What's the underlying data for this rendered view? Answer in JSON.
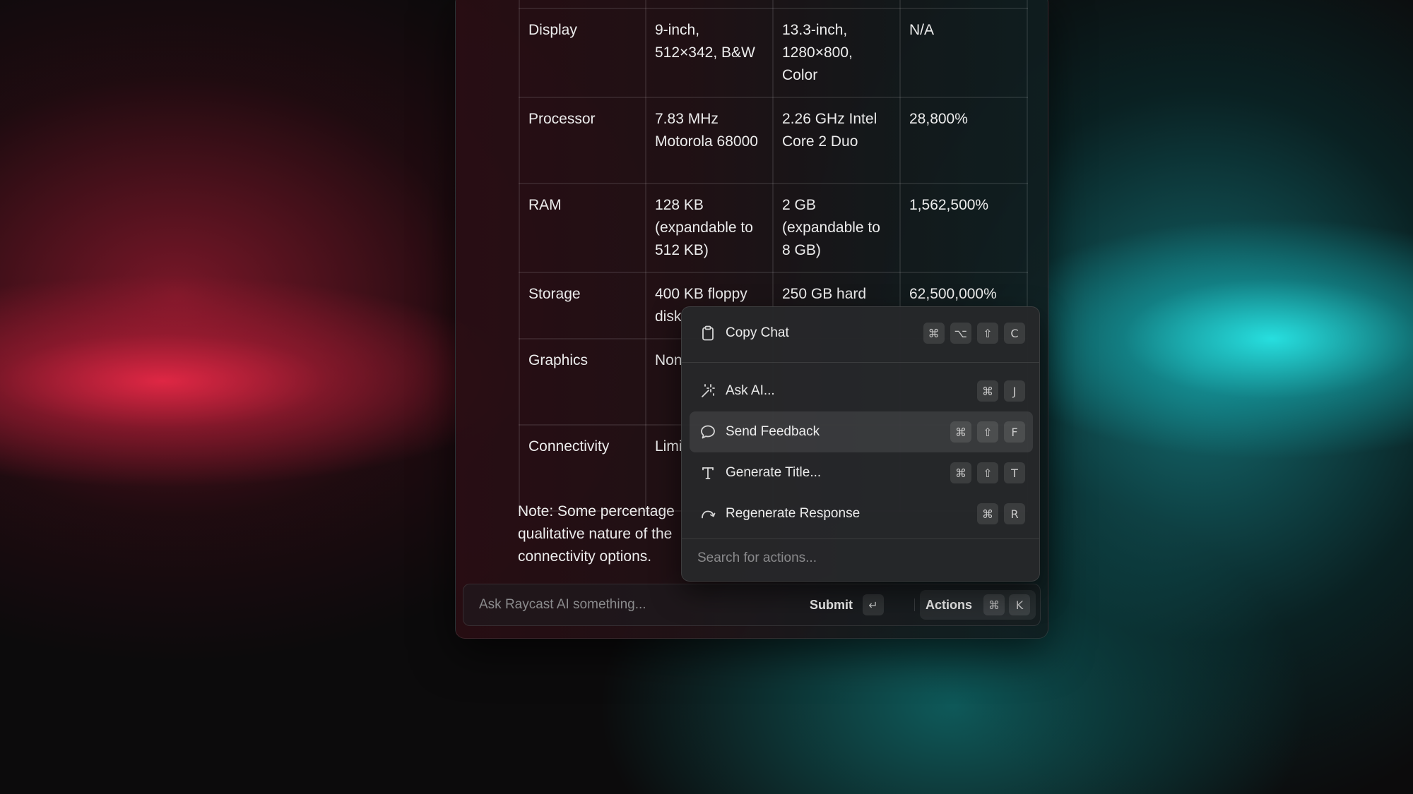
{
  "specs_table": {
    "rows": [
      {
        "feature": "Display",
        "col1": "9-inch, 512×342, B&W",
        "col2": "13.3-inch, 1280×800, Color",
        "col3": "N/A"
      },
      {
        "feature": "Processor",
        "col1": "7.83 MHz Motorola 68000",
        "col2": "2.26 GHz Intel Core 2 Duo",
        "col3": "28,800%"
      },
      {
        "feature": "RAM",
        "col1": "128 KB (expandable to 512 KB)",
        "col2": "2 GB (expandable to 8 GB)",
        "col3": "1,562,500%"
      },
      {
        "feature": "Storage",
        "col1": "400 KB floppy disk",
        "col2": "250 GB hard",
        "col3": "62,500,000%"
      },
      {
        "feature": "Graphics",
        "col1": "Non",
        "col2": "",
        "col3": ""
      },
      {
        "feature": "Connectivity",
        "col1": "Limi",
        "col2": "",
        "col3": ""
      }
    ]
  },
  "note": {
    "line1": "Note: Some percentage",
    "line2": "qualitative nature of the",
    "line3": "connectivity options."
  },
  "input_bar": {
    "placeholder": "Ask Raycast AI something...",
    "submit_label": "Submit",
    "submit_key": "↵",
    "actions_label": "Actions",
    "actions_keys": [
      "⌘",
      "K"
    ]
  },
  "action_menu": {
    "items": [
      {
        "label": "Copy Chat",
        "icon": "clipboard-icon",
        "keys": [
          "⌘",
          "⌥",
          "⇧",
          "C"
        ]
      },
      {
        "label": "Ask AI...",
        "icon": "magic-wand-icon",
        "keys": [
          "⌘",
          "J"
        ]
      },
      {
        "label": "Send Feedback",
        "icon": "speech-bubble-icon",
        "keys": [
          "⌘",
          "⇧",
          "F"
        ],
        "selected": true
      },
      {
        "label": "Generate Title...",
        "icon": "text-t-icon",
        "keys": [
          "⌘",
          "⇧",
          "T"
        ]
      },
      {
        "label": "Regenerate Response",
        "icon": "redo-arrow-icon",
        "keys": [
          "⌘",
          "R"
        ]
      }
    ],
    "search_placeholder": "Search for actions..."
  }
}
